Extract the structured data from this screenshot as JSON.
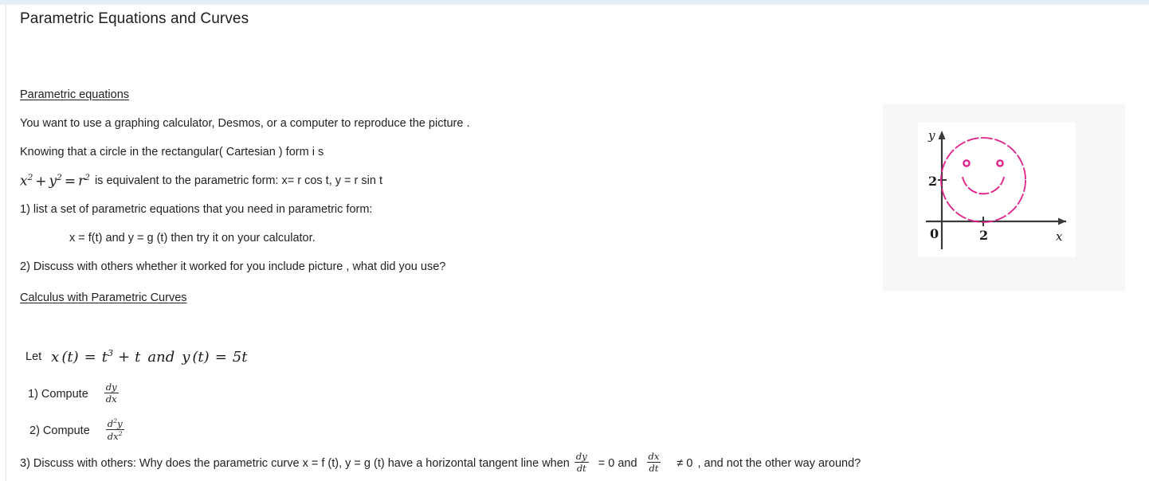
{
  "page": {
    "title": "Parametric Equations and Curves",
    "accent_bar_color": "#e4eff6",
    "text_color": "#222222",
    "curve_color": "#e0218a"
  },
  "section1": {
    "heading": "Parametric equations",
    "line1": "You want to use a graphing calculator, Desmos, or a computer  to reproduce the picture .",
    "line2": "Knowing that a circle in the rectangular( Cartesian ) form i s",
    "equation": {
      "x": "x",
      "x_exp": "2",
      "plus": "+",
      "y": "y",
      "y_exp": "2",
      "equals": "=",
      "r": "r",
      "r_exp": "2",
      "tail": "is  equivalent to the parametric form:  x= r cos t,    y = r sin t"
    },
    "item1": "1) list a set of parametric equations that you need in parametric form:",
    "item1_sub": "x = f(t)   and   y = g (t)    then try it on your calculator.",
    "item2": "2) Discuss with others  whether it worked for you include picture , what did you use?"
  },
  "section2": {
    "heading": "Calculus with Parametric Curves ",
    "let_label": "Let",
    "let_equation": {
      "x": "x",
      "paren_t_1": "(t)",
      "eq1": "=",
      "t": "t",
      "t_exp": "3",
      "plus": "+",
      "t2": "t",
      "and": "and",
      "y": "y",
      "paren_t_2": "(t)",
      "eq2": "=",
      "rhs": "5t"
    },
    "item1_label": "1) Compute",
    "item1_frac": {
      "num": "dy",
      "den": "dx"
    },
    "item2_label": "2) Compute",
    "item2_frac": {
      "num": "d",
      "num_exp": "2",
      "num_var": "y",
      "den": "dx",
      "den_exp": "2"
    },
    "item3": {
      "prefix": "3)  Discuss with others: Why does the parametric curve x = f (t),    y = g (t)     have a horizontal tangent line when",
      "frac1": {
        "num": "dy",
        "den": "dt"
      },
      "mid1": "=  0  and",
      "frac2": {
        "num": "dx",
        "den": "dt"
      },
      "mid2": "≠  0",
      "suffix": ", and not the other way around?"
    }
  },
  "figure": {
    "name": "smiley-face-parametric-graph",
    "y_axis_label": "y",
    "x_axis_label": "x",
    "origin_label": "0",
    "y_tick_label": "2",
    "x_tick_label": "2",
    "curve_color": "#e0218a",
    "axis_color": "#3a3a3a"
  },
  "chart_data": {
    "type": "scatter",
    "title": "",
    "xlabel": "x",
    "ylabel": "y",
    "xlim": [
      -0.6,
      5.4
    ],
    "ylim": [
      -0.5,
      4.6
    ],
    "xticks": [
      0,
      2
    ],
    "yticks": [
      0,
      2
    ],
    "grid": false,
    "legend": "none",
    "annotations": [
      "Face circle: center (2, 2), radius 2",
      "Left eye: small circle center (1.2, 2.8), radius 0.1",
      "Right eye: small circle center (2.8, 2.8), radius 0.1",
      "Mouth: lower semicircular arc, center (2, 2), radius 1"
    ],
    "series": [
      {
        "name": "face",
        "shape": "circle",
        "center": [
          2,
          2
        ],
        "radius": 2
      },
      {
        "name": "left-eye",
        "shape": "circle",
        "center": [
          1.2,
          2.8
        ],
        "radius": 0.1
      },
      {
        "name": "right-eye",
        "shape": "circle",
        "center": [
          2.8,
          2.8
        ],
        "radius": 0.1
      },
      {
        "name": "mouth",
        "shape": "arc",
        "center": [
          2,
          2
        ],
        "radius": 1,
        "theta_deg": [
          200,
          340
        ]
      }
    ]
  }
}
